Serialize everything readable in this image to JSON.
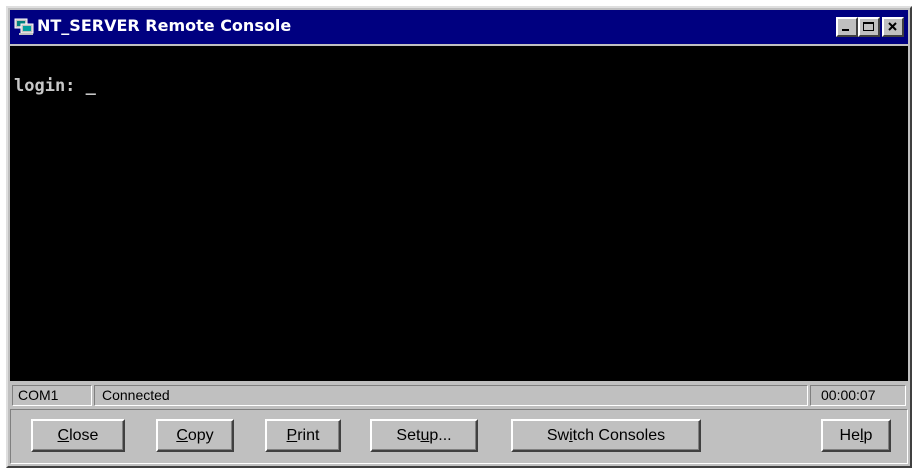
{
  "window": {
    "title": "NT_SERVER Remote Console",
    "icon": "computer-icon",
    "controls": [
      "minimize-icon",
      "maximize-icon",
      "close-icon"
    ]
  },
  "console": {
    "prompt": "login: _"
  },
  "statusbar": {
    "port": "COM1",
    "state": "Connected",
    "elapsed": "00:00:07"
  },
  "buttons": {
    "close": {
      "first": "C",
      "rest": "lose"
    },
    "copy": {
      "first": "C",
      "rest": "opy"
    },
    "print": {
      "first": "P",
      "rest": "rint"
    },
    "setup": {
      "before": "Set",
      "mnemonic": "u",
      "after": "p..."
    },
    "switch": {
      "before": "Sw",
      "mnemonic": "i",
      "after": "tch Consoles"
    },
    "help": {
      "before": "He",
      "mnemonic": "l",
      "after": "p"
    }
  },
  "colors": {
    "titlebar": "#000080",
    "console_bg": "#000000",
    "console_fg": "#c8c8c8",
    "face": "#c0c0c0"
  }
}
